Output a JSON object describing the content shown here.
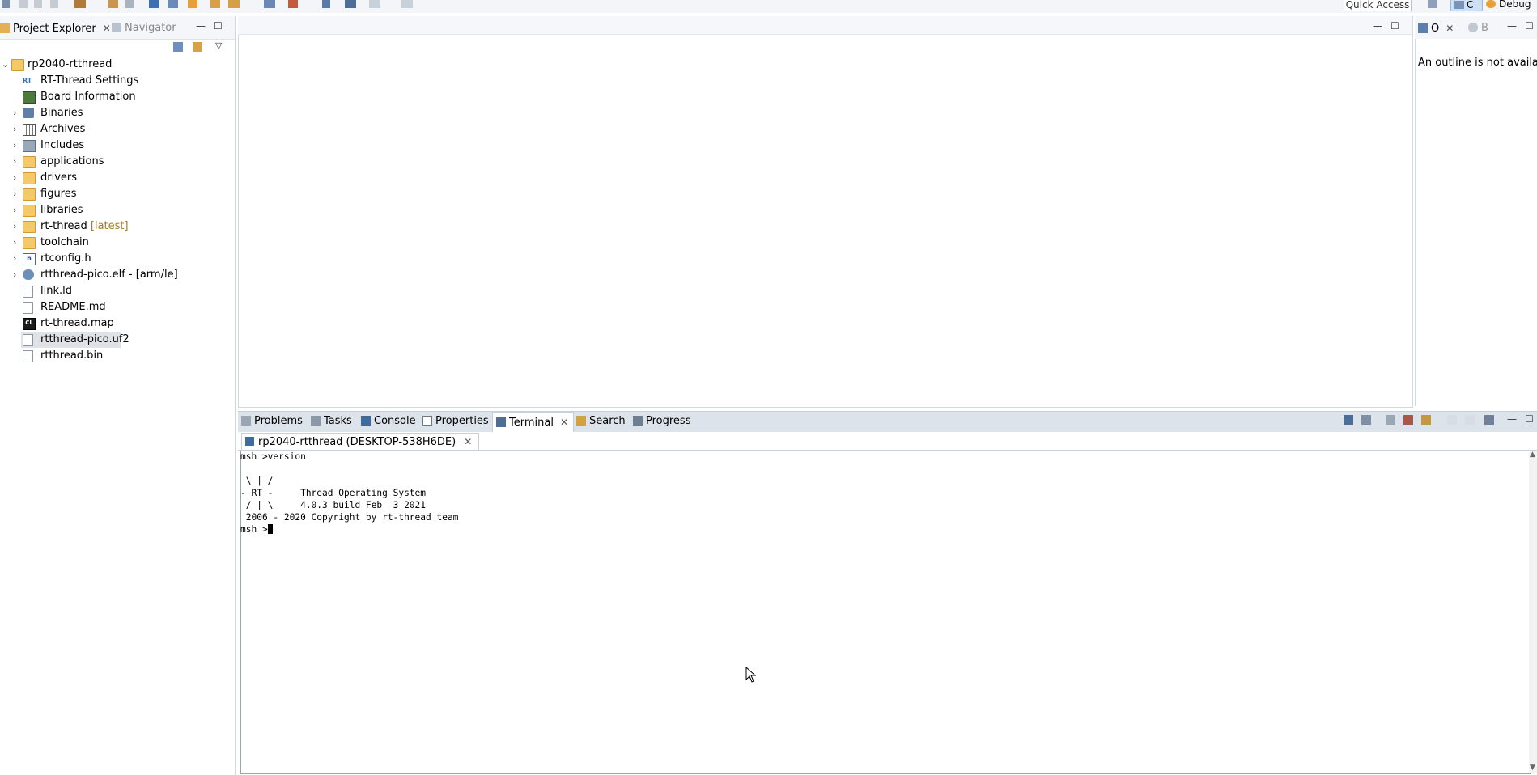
{
  "toolbar": {
    "quick_access": "Quick Access",
    "perspective_c": "C",
    "perspective_debug": "Debug"
  },
  "left_panel": {
    "tabs": [
      {
        "label": "Project Explorer",
        "icon": "folder-icon"
      },
      {
        "label": "Navigator",
        "icon": "navigator-icon"
      }
    ],
    "tree": [
      {
        "label": "rp2040-rtthread",
        "icon": "project-icon",
        "expanded": true
      },
      {
        "label": "RT-Thread Settings",
        "icon": "rt-icon"
      },
      {
        "label": "Board Information",
        "icon": "board-icon"
      },
      {
        "label": "Binaries",
        "icon": "binaries-icon",
        "expandable": true
      },
      {
        "label": "Archives",
        "icon": "archives-icon",
        "expandable": true
      },
      {
        "label": "Includes",
        "icon": "includes-icon",
        "expandable": true
      },
      {
        "label": "applications",
        "icon": "folder-icon",
        "expandable": true
      },
      {
        "label": "drivers",
        "icon": "folder-icon",
        "expandable": true
      },
      {
        "label": "figures",
        "icon": "folder-icon",
        "expandable": true
      },
      {
        "label": "libraries",
        "icon": "folder-icon",
        "expandable": true
      },
      {
        "label": "rt-thread",
        "annotation": "[latest]",
        "icon": "folder-icon",
        "expandable": true
      },
      {
        "label": "toolchain",
        "icon": "folder-icon",
        "expandable": true
      },
      {
        "label": "rtconfig.h",
        "icon": "header-file-icon",
        "expandable": true
      },
      {
        "label": "rtthread-pico.elf - [arm/le]",
        "icon": "elf-icon",
        "expandable": true
      },
      {
        "label": "link.ld",
        "icon": "file-icon"
      },
      {
        "label": "README.md",
        "icon": "file-icon"
      },
      {
        "label": "rt-thread.map",
        "icon": "map-file-icon"
      },
      {
        "label": "rtthread-pico.uf2",
        "icon": "file-icon",
        "selected": true
      },
      {
        "label": "rtthread.bin",
        "icon": "file-icon"
      }
    ]
  },
  "outline": {
    "tab_o": "O",
    "tab_b": "B",
    "message": "An outline is not available."
  },
  "bottom_tabs": [
    {
      "label": "Problems",
      "icon": "problems-icon"
    },
    {
      "label": "Tasks",
      "icon": "tasks-icon"
    },
    {
      "label": "Console",
      "icon": "console-icon"
    },
    {
      "label": "Properties",
      "icon": "properties-icon"
    },
    {
      "label": "Terminal",
      "icon": "terminal-icon",
      "active": true
    },
    {
      "label": "Search",
      "icon": "search-icon"
    },
    {
      "label": "Progress",
      "icon": "progress-icon"
    }
  ],
  "terminal": {
    "tab_label": "rp2040-rtthread (DESKTOP-538H6DE)",
    "lines": [
      "msh >version",
      "",
      " \\ | /",
      "- RT -     Thread Operating System",
      " / | \\     4.0.3 build Feb  3 2021",
      " 2006 - 2020 Copyright by rt-thread team",
      "msh >"
    ]
  }
}
